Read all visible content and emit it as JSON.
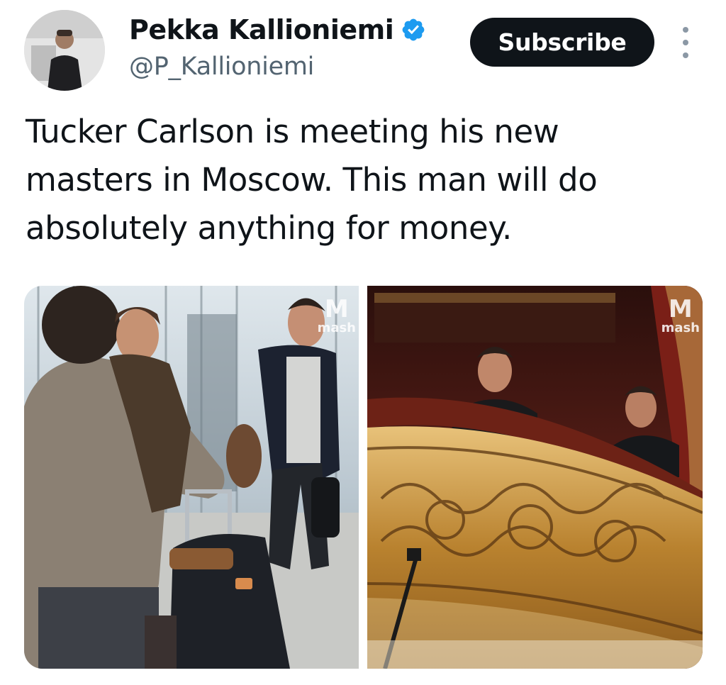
{
  "author": {
    "display_name": "Pekka Kallioniemi",
    "handle": "@P_Kallioniemi",
    "verified": true,
    "avatar_icon": "profile-photo"
  },
  "actions": {
    "subscribe_label": "Subscribe",
    "more_icon": "vertical-ellipsis-icon"
  },
  "tweet": {
    "text": "Tucker Carlson is meeting his new masters in Moscow. This man will do absolutely anything for money."
  },
  "media": {
    "photos": [
      {
        "watermark_mark": "M",
        "watermark_text": "mash"
      },
      {
        "watermark_mark": "M",
        "watermark_text": "mash"
      }
    ]
  },
  "colors": {
    "text_primary": "#0f1419",
    "text_secondary": "#536471",
    "verified_blue": "#1d9bf0",
    "button_bg": "#0f1419",
    "button_text": "#ffffff"
  }
}
